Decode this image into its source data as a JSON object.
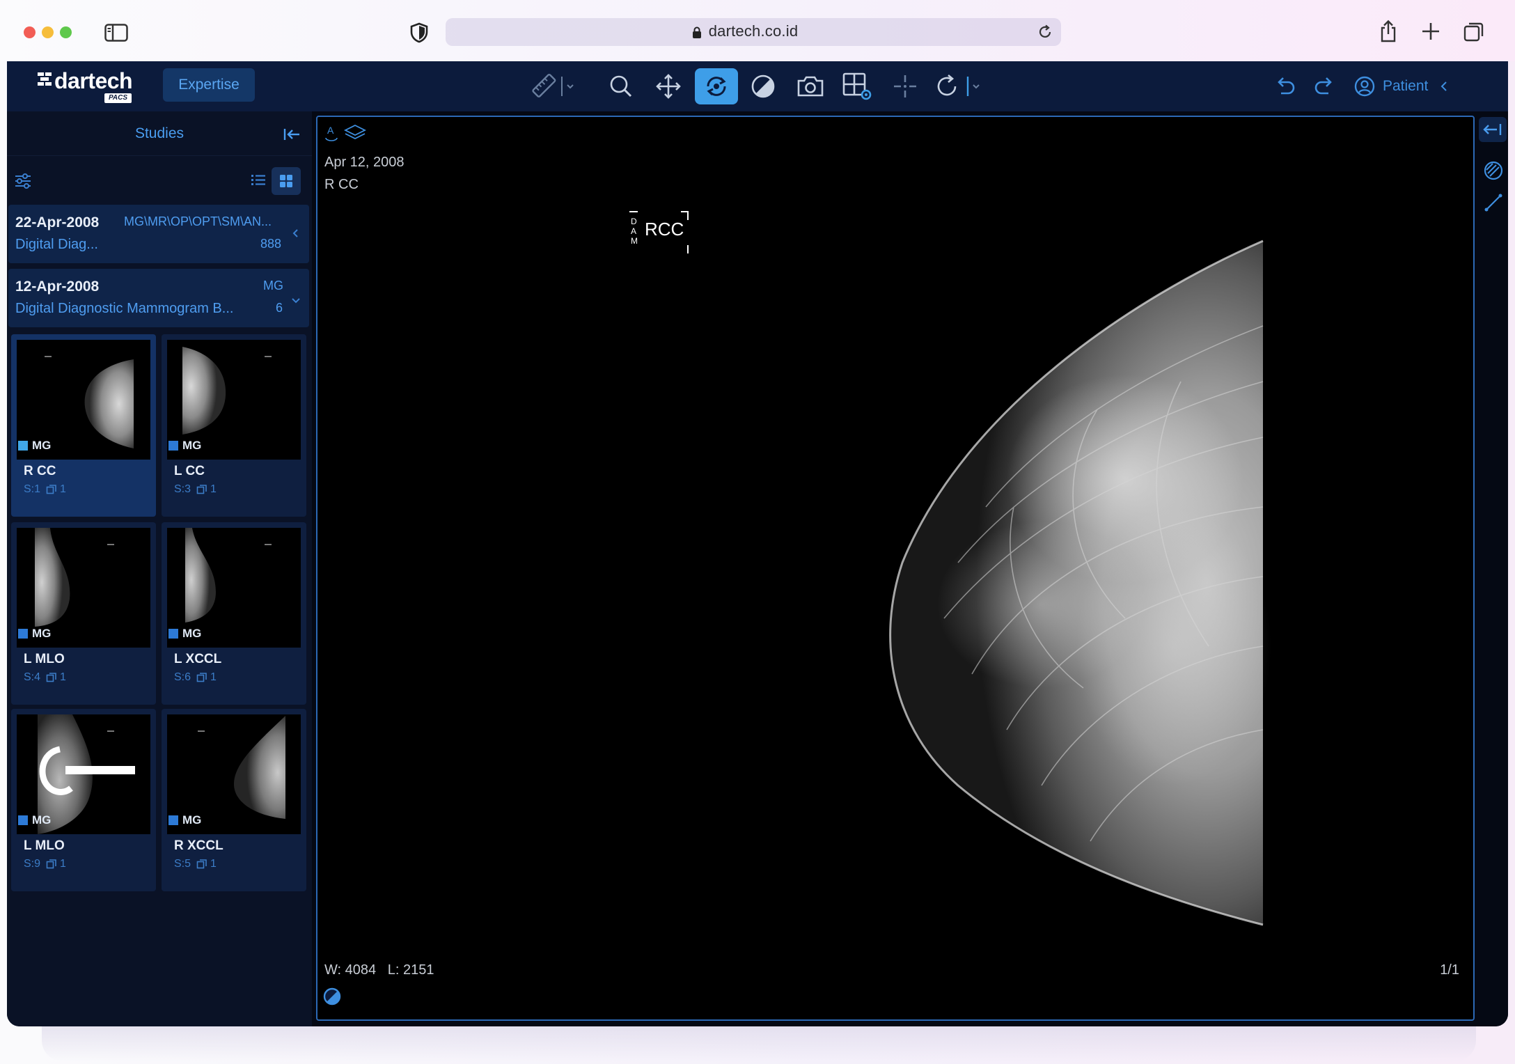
{
  "browser": {
    "url": "dartech.co.id"
  },
  "app": {
    "logo_text": "dartech",
    "logo_badge": "PACS",
    "expertise_label": "Expertise",
    "patient_label": "Patient",
    "toolbar_tools": [
      "ruler-icon",
      "zoom-icon",
      "pan-icon",
      "rotate-icon",
      "contrast-icon",
      "camera-icon",
      "layout-icon",
      "crosshair-icon",
      "reset-icon"
    ],
    "active_tool": "rotate-icon",
    "colors": {
      "topbar": "#0c1b3c",
      "accent": "#3e9ee8",
      "link": "#4a9df0",
      "panel": "#0a1226",
      "card": "#0f2449"
    }
  },
  "studies": {
    "title": "Studies",
    "items": [
      {
        "date": "22-Apr-2008",
        "description": "Digital Diag...",
        "modality": "MG\\MR\\OP\\OPT\\SM\\AN...",
        "count": "888",
        "expanded": false
      },
      {
        "date": "12-Apr-2008",
        "description": "Digital Diagnostic Mammogram B...",
        "modality": "MG",
        "count": "6",
        "expanded": true
      }
    ],
    "series": [
      {
        "modality": "MG",
        "label": "R CC",
        "series": "S:1",
        "images": "1",
        "selected": true
      },
      {
        "modality": "MG",
        "label": "L CC",
        "series": "S:3",
        "images": "1",
        "selected": false
      },
      {
        "modality": "MG",
        "label": "L MLO",
        "series": "S:4",
        "images": "1",
        "selected": false
      },
      {
        "modality": "MG",
        "label": "L XCCL",
        "series": "S:6",
        "images": "1",
        "selected": false
      },
      {
        "modality": "MG",
        "label": "L MLO",
        "series": "S:9",
        "images": "1",
        "selected": false
      },
      {
        "modality": "MG",
        "label": "R XCCL",
        "series": "S:5",
        "images": "1",
        "selected": false
      }
    ]
  },
  "viewport": {
    "date": "Apr 12, 2008",
    "view": "R CC",
    "marker": "RCC",
    "window": "W: 4084",
    "level": "L: 2151",
    "frame": "1/1"
  }
}
